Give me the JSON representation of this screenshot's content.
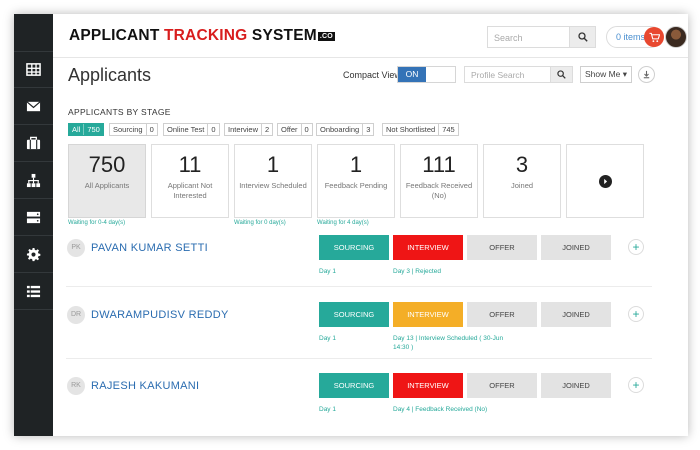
{
  "brand": {
    "part1": "APPLICANT ",
    "part2": "TRACKING",
    "part3": " SYSTEM",
    "badge": ".CO"
  },
  "header": {
    "search_placeholder": "Search",
    "cart_label": "0 items"
  },
  "sidebar": {
    "items": [
      "grid-icon",
      "mail-icon",
      "briefcase-icon",
      "org-chart-icon",
      "server-icon",
      "gear-icon",
      "list-icon"
    ]
  },
  "page": {
    "title": "Applicants",
    "compact_view_label": "Compact View",
    "toggle_state": "ON",
    "profile_search_placeholder": "Profile Search",
    "show_me_label": "Show Me ▾"
  },
  "stages": {
    "heading": "APPLICANTS BY STAGE",
    "filters": [
      {
        "label": "All",
        "count": "750"
      },
      {
        "label": "Sourcing",
        "count": "0"
      },
      {
        "label": "Online Test",
        "count": "0"
      },
      {
        "label": "Interview",
        "count": "2"
      },
      {
        "label": "Offer",
        "count": "0"
      },
      {
        "label": "Onboarding",
        "count": "3"
      },
      {
        "label": "Not Shortlisted",
        "count": "745"
      }
    ],
    "cards": [
      {
        "value": "750",
        "label": "All Applicants"
      },
      {
        "value": "11",
        "label": "Applicant Not Interested"
      },
      {
        "value": "1",
        "label": "Interview Scheduled"
      },
      {
        "value": "1",
        "label": "Feedback Pending"
      },
      {
        "value": "111",
        "label": "Feedback Received (No)"
      },
      {
        "value": "3",
        "label": "Joined"
      }
    ],
    "waiting": [
      "Waiting for 0-4 day(s)",
      "Waiting for 0 day(s)",
      "Waiting for 4 day(s)"
    ]
  },
  "applicants": [
    {
      "initials": "PK",
      "name": "PAVAN KUMAR SETTI",
      "stages": [
        "SOURCING",
        "INTERVIEW",
        "OFFER",
        "JOINED"
      ],
      "notes": [
        "Day 1",
        "Day 3 | Rejected"
      ]
    },
    {
      "initials": "DR",
      "name": "DWARAMPUDISV REDDY",
      "stages": [
        "SOURCING",
        "INTERVIEW",
        "OFFER",
        "JOINED"
      ],
      "notes": [
        "Day 1",
        "Day 13 | Interview Scheduled ( 30-Jun",
        "14:30 )"
      ]
    },
    {
      "initials": "RK",
      "name": "RAJESH KAKUMANI",
      "stages": [
        "SOURCING",
        "INTERVIEW",
        "OFFER",
        "JOINED"
      ],
      "notes": [
        "Day 1",
        "Day 4 | Feedback Received (No)"
      ]
    }
  ],
  "colors": {
    "teal": "#26a99a",
    "red": "#ef1515",
    "orange": "#f4ae27",
    "blue": "#3473b7",
    "sidebar": "#1f2325"
  }
}
